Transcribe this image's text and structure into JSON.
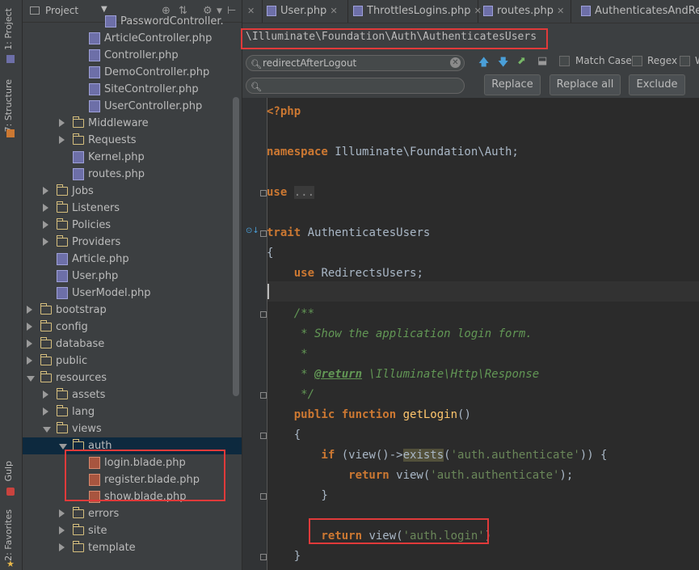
{
  "project_panel": {
    "title": "Project",
    "tree": [
      {
        "label": "PasswordController.",
        "kind": "php",
        "indent": 6
      },
      {
        "label": "ArticleController.php",
        "kind": "php",
        "indent": 5
      },
      {
        "label": "Controller.php",
        "kind": "php",
        "indent": 5
      },
      {
        "label": "DemoController.php",
        "kind": "php",
        "indent": 5
      },
      {
        "label": "SiteController.php",
        "kind": "php",
        "indent": 5
      },
      {
        "label": "UserController.php",
        "kind": "php",
        "indent": 5
      },
      {
        "label": "Middleware",
        "kind": "folder",
        "indent": 4,
        "state": "collapsed"
      },
      {
        "label": "Requests",
        "kind": "folder",
        "indent": 4,
        "state": "collapsed"
      },
      {
        "label": "Kernel.php",
        "kind": "php",
        "indent": 4
      },
      {
        "label": "routes.php",
        "kind": "php",
        "indent": 4
      },
      {
        "label": "Jobs",
        "kind": "folder",
        "indent": 3,
        "state": "collapsed"
      },
      {
        "label": "Listeners",
        "kind": "folder",
        "indent": 3,
        "state": "collapsed"
      },
      {
        "label": "Policies",
        "kind": "folder",
        "indent": 3,
        "state": "collapsed"
      },
      {
        "label": "Providers",
        "kind": "folder",
        "indent": 3,
        "state": "collapsed"
      },
      {
        "label": "Article.php",
        "kind": "php",
        "indent": 3
      },
      {
        "label": "User.php",
        "kind": "php",
        "indent": 3
      },
      {
        "label": "UserModel.php",
        "kind": "php",
        "indent": 3
      },
      {
        "label": "bootstrap",
        "kind": "folder",
        "indent": 2,
        "state": "collapsed"
      },
      {
        "label": "config",
        "kind": "folder",
        "indent": 2,
        "state": "collapsed"
      },
      {
        "label": "database",
        "kind": "folder",
        "indent": 2,
        "state": "collapsed"
      },
      {
        "label": "public",
        "kind": "folder",
        "indent": 2,
        "state": "collapsed"
      },
      {
        "label": "resources",
        "kind": "folder",
        "indent": 2,
        "state": "expanded"
      },
      {
        "label": "assets",
        "kind": "folder",
        "indent": 3,
        "state": "collapsed"
      },
      {
        "label": "lang",
        "kind": "folder",
        "indent": 3,
        "state": "collapsed"
      },
      {
        "label": "views",
        "kind": "folder",
        "indent": 3,
        "state": "expanded"
      },
      {
        "label": "auth",
        "kind": "folder",
        "indent": 4,
        "state": "expanded",
        "selected": true
      },
      {
        "label": "login.blade.php",
        "kind": "blade",
        "indent": 5
      },
      {
        "label": "register.blade.php",
        "kind": "blade",
        "indent": 5
      },
      {
        "label": "show.blade.php",
        "kind": "blade",
        "indent": 5
      },
      {
        "label": "errors",
        "kind": "folder",
        "indent": 4,
        "state": "collapsed"
      },
      {
        "label": "site",
        "kind": "folder",
        "indent": 4,
        "state": "collapsed"
      },
      {
        "label": "template",
        "kind": "folder",
        "indent": 4,
        "state": "collapsed"
      }
    ]
  },
  "side_strip": {
    "project_tab": "1: Project",
    "structure_tab": "7: Structure",
    "gulp_tab": "Gulp",
    "favorites_tab": "2: Favorites"
  },
  "tabs": [
    {
      "label": "User.php"
    },
    {
      "label": "ThrottlesLogins.php"
    },
    {
      "label": "routes.php"
    },
    {
      "label": "AuthenticatesAndRegi"
    }
  ],
  "path": "\\Illuminate\\Foundation\\Auth\\AuthenticatesUsers",
  "find": {
    "search_value": "redirectAfterLogout",
    "replace_value": "",
    "match_case_label": "Match Case",
    "regex_label": "Regex",
    "w_label": "W",
    "replace_btn": "Replace",
    "replace_all_btn": "Replace all",
    "exclude_btn": "Exclude"
  },
  "code": {
    "l1": "<?php",
    "l3a": "namespace",
    "l3b": " Illuminate\\Foundation\\Auth;",
    "l5a": "use",
    "l5b": "...",
    "l7a": "trait",
    "l7b": " AuthenticatesUsers",
    "l8": "{",
    "l9a": "    use",
    "l9b": " RedirectsUsers;",
    "l11": "    /**",
    "l12": "     * Show the application login form.",
    "l13": "     *",
    "l14a": "     * ",
    "l14b": "@return",
    "l14c": " \\Illuminate\\Http\\Response",
    "l15": "     */",
    "l16a": "    public function",
    "l16b": " getLogin",
    "l16c": "()",
    "l17": "    {",
    "l18a": "        if",
    "l18b": " (view()->",
    "l18c": "exists",
    "l18d": "(",
    "l18e": "'auth.authenticate'",
    "l18f": ")) {",
    "l19a": "            return",
    "l19b": " view(",
    "l19c": "'auth.authenticate'",
    "l19d": ");",
    "l20": "        }",
    "l22a": "        return",
    "l22b": " view(",
    "l22c": "'auth.login'",
    "l22d": ")",
    "l23": "    }"
  }
}
